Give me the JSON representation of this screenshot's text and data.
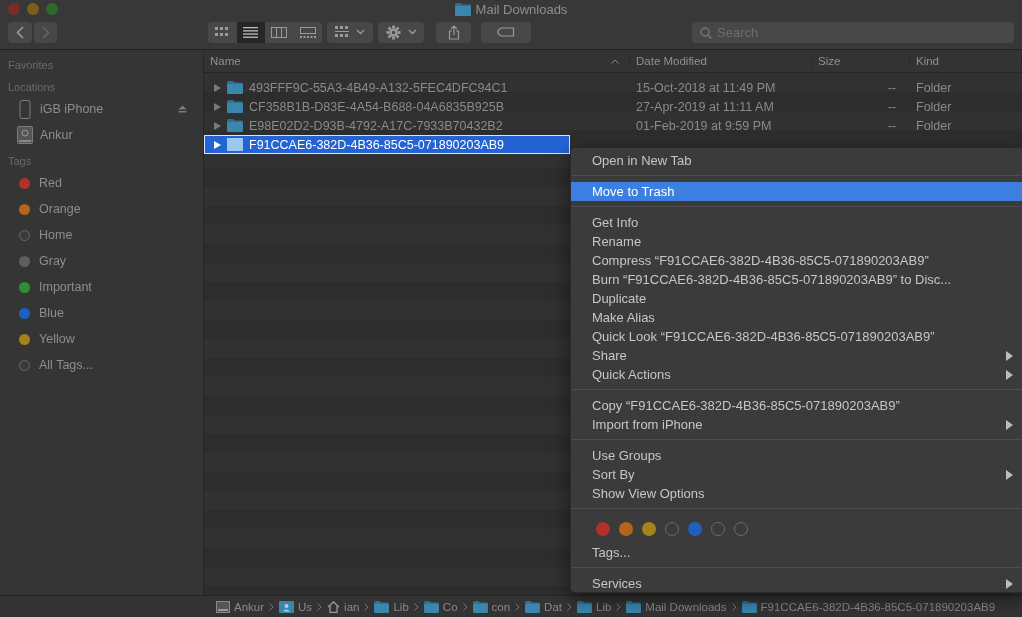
{
  "window": {
    "title": "Mail Downloads"
  },
  "toolbar": {
    "views": [
      {
        "kind": "icons",
        "selected": false
      },
      {
        "kind": "list",
        "selected": true
      },
      {
        "kind": "columns",
        "selected": false
      },
      {
        "kind": "gallery",
        "selected": false
      }
    ],
    "search": {
      "placeholder": "Search"
    }
  },
  "sidebar": {
    "sections": [
      {
        "title": "Favorites"
      },
      {
        "title": "Locations",
        "items": [
          {
            "label": "iGB iPhone",
            "kind": "phone",
            "eject": true
          },
          {
            "label": "Ankur",
            "kind": "disk",
            "eject": false
          }
        ]
      },
      {
        "title": "Tags",
        "items": [
          {
            "label": "Red",
            "kind": "tag",
            "color": "#b3312b"
          },
          {
            "label": "Orange",
            "kind": "tag",
            "color": "#b4651c"
          },
          {
            "label": "Home",
            "kind": "tag-ring",
            "color": "#6a6a6a"
          },
          {
            "label": "Gray",
            "kind": "tag",
            "color": "#5e5e60"
          },
          {
            "label": "Important",
            "kind": "tag",
            "color": "#2f8f33"
          },
          {
            "label": "Blue",
            "kind": "tag",
            "color": "#1f5fbf"
          },
          {
            "label": "Yellow",
            "kind": "tag",
            "color": "#a5821a"
          },
          {
            "label": "All Tags...",
            "kind": "tag-ring",
            "color": "#6a6a6a"
          }
        ]
      }
    ]
  },
  "table": {
    "columns": [
      {
        "label": "Name",
        "sorted": true
      },
      {
        "label": "Date Modified",
        "sorted": false
      },
      {
        "label": "Size",
        "sorted": false
      },
      {
        "label": "Kind",
        "sorted": false
      }
    ],
    "rows": [
      {
        "name": "493FFF9C-55A3-4B49-A132-5FEC4DFC94C1",
        "date": "15-Oct-2018 at 11:49 PM",
        "size": "--",
        "kind": "Folder",
        "selected": false
      },
      {
        "name": "CF358B1B-D83E-4A54-B688-04A6835B925B",
        "date": "27-Apr-2019 at 11:11 AM",
        "size": "--",
        "kind": "Folder",
        "selected": false
      },
      {
        "name": "E98E02D2-D93B-4792-A17C-7933B70432B2",
        "date": "01-Feb-2019 at 9:59 PM",
        "size": "--",
        "kind": "Folder",
        "selected": false
      },
      {
        "name": "F91CCAE6-382D-4B36-85C5-071890203AB9",
        "selected": true
      }
    ]
  },
  "context_menu": {
    "sections": [
      {
        "items": [
          {
            "label": "Open in New Tab",
            "selected": false,
            "submenu": false
          }
        ]
      },
      {
        "items": [
          {
            "label": "Move to Trash",
            "selected": true,
            "submenu": false
          }
        ]
      },
      {
        "items": [
          {
            "label": "Get Info",
            "selected": false,
            "submenu": false
          },
          {
            "label": "Rename",
            "selected": false,
            "submenu": false
          },
          {
            "label": "Compress “F91CCAE6-382D-4B36-85C5-071890203AB9”",
            "selected": false,
            "submenu": false
          },
          {
            "label": "Burn “F91CCAE6-382D-4B36-85C5-071890203AB9” to Disc...",
            "selected": false,
            "submenu": false
          },
          {
            "label": "Duplicate",
            "selected": false,
            "submenu": false
          },
          {
            "label": "Make Alias",
            "selected": false,
            "submenu": false
          },
          {
            "label": "Quick Look “F91CCAE6-382D-4B36-85C5-071890203AB9”",
            "selected": false,
            "submenu": false
          },
          {
            "label": "Share",
            "selected": false,
            "submenu": true
          },
          {
            "label": "Quick Actions",
            "selected": false,
            "submenu": true
          }
        ]
      },
      {
        "items": [
          {
            "label": "Copy “F91CCAE6-382D-4B36-85C5-071890203AB9”",
            "selected": false,
            "submenu": false
          },
          {
            "label": "Import from iPhone",
            "selected": false,
            "submenu": true
          }
        ]
      },
      {
        "items": [
          {
            "label": "Use Groups",
            "selected": false,
            "submenu": false
          },
          {
            "label": "Sort By",
            "selected": false,
            "submenu": true
          },
          {
            "label": "Show View Options",
            "selected": false,
            "submenu": false
          }
        ]
      },
      {
        "tags": [
          {
            "color": "#b3312b",
            "filled": true
          },
          {
            "color": "#b4651c",
            "filled": true
          },
          {
            "color": "#a5821a",
            "filled": true
          },
          {
            "color": "#6a6a6a",
            "filled": false
          },
          {
            "color": "#1f5fbf",
            "filled": true
          },
          {
            "color": "#6a6a6a",
            "filled": false
          },
          {
            "color": "#6a6a6a",
            "filled": false
          }
        ],
        "items": [
          {
            "label": "Tags...",
            "selected": false,
            "submenu": false
          }
        ]
      },
      {
        "items": [
          {
            "label": "Services",
            "selected": false,
            "submenu": true
          }
        ]
      }
    ]
  },
  "path_bar": [
    {
      "label": "Ankur",
      "kind": "disk"
    },
    {
      "label": "Us",
      "kind": "user"
    },
    {
      "label": "ian",
      "kind": "home"
    },
    {
      "label": "Lib",
      "kind": "folder"
    },
    {
      "label": "Co",
      "kind": "folder"
    },
    {
      "label": "con",
      "kind": "folder"
    },
    {
      "label": "Dat",
      "kind": "folder"
    },
    {
      "label": "Lib",
      "kind": "folder"
    },
    {
      "label": "Mail Downloads",
      "kind": "folder"
    },
    {
      "label": "F91CCAE6-382D-4B36-85C5-071890203AB9",
      "kind": "folder"
    }
  ]
}
